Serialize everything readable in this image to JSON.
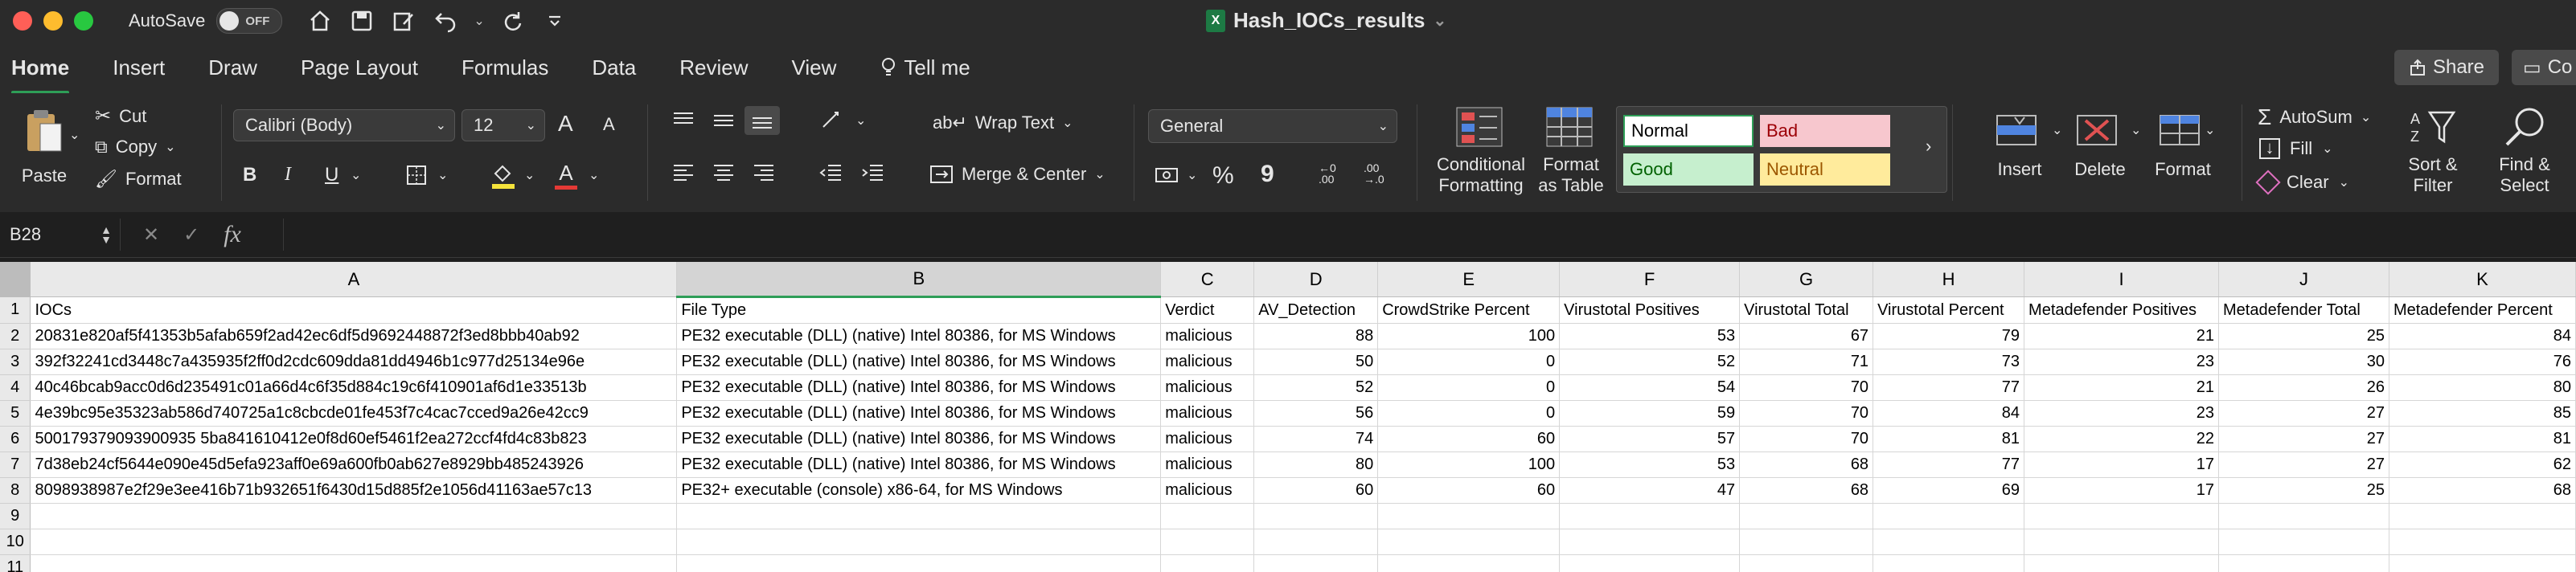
{
  "titlebar": {
    "autosave_label": "AutoSave",
    "toggle_state": "OFF",
    "doc_title": "Hash_IOCs_results",
    "doc_title_chevron": "⌄"
  },
  "menu": {
    "tabs": [
      "Home",
      "Insert",
      "Draw",
      "Page Layout",
      "Formulas",
      "Data",
      "Review",
      "View"
    ],
    "tell_me": "Tell me",
    "share": "Share",
    "comments": "Co"
  },
  "ribbon": {
    "paste": "Paste",
    "cut": "Cut",
    "copy": "Copy",
    "format_painter": "Format",
    "font_name": "Calibri (Body)",
    "font_size": "12",
    "wrap_text": "Wrap Text",
    "merge_center": "Merge & Center",
    "number_format": "General",
    "conditional_1": "Conditional",
    "conditional_2": "Formatting",
    "format_table_1": "Format",
    "format_table_2": "as Table",
    "style_normal": "Normal",
    "style_bad": "Bad",
    "style_good": "Good",
    "style_neutral": "Neutral",
    "insert": "Insert",
    "delete": "Delete",
    "format": "Format",
    "autosum": "AutoSum",
    "fill": "Fill",
    "clear": "Clear",
    "sort_filter_1": "Sort &",
    "sort_filter_2": "Filter",
    "find_select_1": "Find &",
    "find_select_2": "Select",
    "bold": "B",
    "italic": "I",
    "underline": "U",
    "percent": "%",
    "comma": "9",
    "font_grow": "A",
    "font_shrink": "A"
  },
  "formula_bar": {
    "cell_ref": "B28",
    "fx": "fx",
    "value": ""
  },
  "sheet": {
    "columns": [
      "A",
      "B",
      "C",
      "D",
      "E",
      "F",
      "G",
      "H",
      "I",
      "J",
      "K"
    ],
    "row_numbers": [
      "1",
      "2",
      "3",
      "4",
      "5",
      "6",
      "7",
      "8",
      "9",
      "10",
      "11"
    ],
    "header": [
      "IOCs",
      "File Type",
      "Verdict",
      "AV_Detection",
      "CrowdStrike Percent",
      "Virustotal Positives",
      "Virustotal Total",
      "Virustotal Percent",
      "Metadefender Positives",
      "Metadefender Total",
      "Metadefender Percent"
    ],
    "rows": [
      [
        "20831e820af5f41353b5afab659f2ad42ec6df5d9692448872f3ed8bbb40ab92",
        "PE32 executable (DLL) (native) Intel 80386, for MS Windows",
        "malicious",
        "88",
        "100",
        "53",
        "67",
        "79",
        "21",
        "25",
        "84"
      ],
      [
        "392f32241cd3448c7a435935f2ff0d2cdc609dda81dd4946b1c977d25134e96e",
        "PE32 executable (DLL) (native) Intel 80386, for MS Windows",
        "malicious",
        "50",
        "0",
        "52",
        "71",
        "73",
        "23",
        "30",
        "76"
      ],
      [
        "40c46bcab9acc0d6d235491c01a66d4c6f35d884c19c6f410901af6d1e33513b",
        "PE32 executable (DLL) (native) Intel 80386, for MS Windows",
        "malicious",
        "52",
        "0",
        "54",
        "70",
        "77",
        "21",
        "26",
        "80"
      ],
      [
        "4e39bc95e35323ab586d740725a1c8cbcde01fe453f7c4cac7cced9a26e42cc9",
        "PE32 executable (DLL) (native) Intel 80386, for MS Windows",
        "malicious",
        "56",
        "0",
        "59",
        "70",
        "84",
        "23",
        "27",
        "85"
      ],
      [
        "500179379093900935 5ba841610412e0f8d60ef5461f2ea272ccf4fd4c83b823",
        "PE32 executable (DLL) (native) Intel 80386, for MS Windows",
        "malicious",
        "74",
        "60",
        "57",
        "70",
        "81",
        "22",
        "27",
        "81"
      ],
      [
        "7d38eb24cf5644e090e45d5efa923aff0e69a600fb0ab627e8929bb485243926",
        "PE32 executable (DLL) (native) Intel 80386, for MS Windows",
        "malicious",
        "80",
        "100",
        "53",
        "68",
        "77",
        "17",
        "27",
        "62"
      ],
      [
        "8098938987e2f29e3ee416b71b932651f6430d15d885f2e1056d41163ae57c13",
        "PE32+ executable (console) x86-64, for MS Windows",
        "malicious",
        "60",
        "60",
        "47",
        "68",
        "69",
        "17",
        "25",
        "68"
      ]
    ],
    "selected_column": "B"
  },
  "colors": {
    "accent_green": "#2e9e57",
    "style_bad_bg": "#f7c7ce",
    "style_good_bg": "#c6efce",
    "style_neutral_bg": "#ffeb9c"
  }
}
